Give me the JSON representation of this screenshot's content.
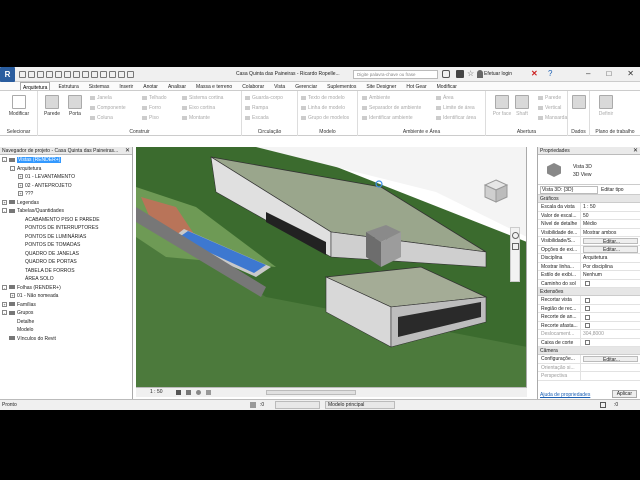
{
  "titlebar": {
    "app_logo": "R",
    "doc_title": "Casa Quinta das Paineiras - Ricardo Ropelle...",
    "search_placeholder": "Digite palavra-chave ou frase",
    "login": "Efetuar login",
    "window_buttons": [
      "–",
      "□",
      "✕"
    ]
  },
  "tabs": [
    "Arquitetura",
    "Estrutura",
    "Sistemas",
    "Inserir",
    "Anotar",
    "Analisar",
    "Massa e terreno",
    "Colaborar",
    "Vista",
    "Gerenciar",
    "Suplementos",
    "Site Designer",
    "Hot Gear",
    "Modificar"
  ],
  "ribbon": {
    "modify": "Modificar",
    "selector": "Selecionar",
    "build": {
      "title": "Construir",
      "big": [
        "Parede",
        "Porta"
      ],
      "items": [
        "Janela",
        "Componente",
        "Coluna",
        "Telhado",
        "Forro",
        "Piso",
        "Sistema cortina",
        "Eixo cortina",
        "Montante"
      ]
    },
    "circulation": {
      "title": "Circulação",
      "items": [
        "Guarda-corpo",
        "Rampa",
        "Escada"
      ]
    },
    "model": {
      "title": "Modelo",
      "items": [
        "Texto de modelo",
        "Linha de modelo",
        "Grupo de modelos"
      ]
    },
    "room": {
      "title": "Ambiente e Área",
      "items": [
        "Ambiente",
        "Separador de ambiente",
        "Identificar ambiente",
        "Área",
        "Limite de área",
        "Identificar área"
      ]
    },
    "opening": {
      "title": "Abertura",
      "items": [
        "Por face",
        "Shaft",
        "Parede",
        "Vertical",
        "Mansarda"
      ]
    },
    "datum": {
      "title": "Dados"
    },
    "workplane": {
      "title": "Plano de trabalho",
      "items": [
        "Definir"
      ]
    }
  },
  "project_browser": {
    "header": "Navegador de projeto - Casa Quinta das Paineiras...",
    "tree": [
      {
        "label": "Vistas (RENDER+)",
        "level": 0,
        "toggle": "-",
        "selected": true
      },
      {
        "label": "Arquitetura",
        "level": 1,
        "toggle": "-"
      },
      {
        "label": "01 - LEVANTAMENTO",
        "level": 2,
        "toggle": "+"
      },
      {
        "label": "02 - ANTEPROJETO",
        "level": 2,
        "toggle": "+"
      },
      {
        "label": "???",
        "level": 2,
        "toggle": "+"
      },
      {
        "label": "Legendas",
        "level": 0,
        "toggle": "+"
      },
      {
        "label": "Tabelas/Quantidades",
        "level": 0,
        "toggle": "-"
      },
      {
        "label": "ACABAMENTO PISO E PAREDE",
        "level": 2
      },
      {
        "label": "PONTOS DE INTERRUPTORES",
        "level": 2
      },
      {
        "label": "PONTOS DE LUMINÁRIAS",
        "level": 2
      },
      {
        "label": "PONTOS DE TOMADAS",
        "level": 2
      },
      {
        "label": "QUADRO DE JANELAS",
        "level": 2
      },
      {
        "label": "QUADRO DE PORTAS",
        "level": 2
      },
      {
        "label": "TABELA DE FORROS",
        "level": 2
      },
      {
        "label": "ÁREA SOLO",
        "level": 2
      },
      {
        "label": "Folhas (RENDER+)",
        "level": 0,
        "toggle": "-"
      },
      {
        "label": "01 - Não nomeada",
        "level": 1,
        "toggle": "+"
      },
      {
        "label": "Famílias",
        "level": 0,
        "toggle": "+"
      },
      {
        "label": "Grupos",
        "level": 0,
        "toggle": "-"
      },
      {
        "label": "Detalhe",
        "level": 1
      },
      {
        "label": "Modelo",
        "level": 1
      },
      {
        "label": "Vínculos do Revit",
        "level": 0
      }
    ]
  },
  "view_control": {
    "scale": "1 : 50"
  },
  "properties": {
    "header": "Propriedades",
    "type_name": "Vista 3D",
    "type_sub": "3D View",
    "instance": "Vista 3D: {3D}",
    "edit_type": "Editar tipo",
    "groups": [
      {
        "name": "Gráficos",
        "rows": [
          [
            "Escala da vista",
            "1 : 50"
          ],
          [
            "Valor de escal...",
            "50"
          ],
          [
            "Nível de detalhe",
            "Médio"
          ],
          [
            "Visibilidade de...",
            "Mostrar ambos"
          ],
          [
            "Visibilidade/S...",
            "Editar...",
            "btn"
          ],
          [
            "Opções de exi...",
            "Editar...",
            "btn"
          ],
          [
            "Disciplina",
            "Arquitetura"
          ],
          [
            "Mostrar linha...",
            "Por disciplina"
          ],
          [
            "Estilo de exibi...",
            "Nenhum"
          ],
          [
            "Caminho do sol",
            "",
            "cb"
          ]
        ]
      },
      {
        "name": "Extensões",
        "rows": [
          [
            "Recortar vista",
            "",
            "cb"
          ],
          [
            "Região de rec...",
            "",
            "cb"
          ],
          [
            "Recorte de an...",
            "",
            "cb"
          ],
          [
            "Recorte afasta...",
            "",
            "cb"
          ],
          [
            "Deslocament...",
            "304,8000",
            "grey"
          ],
          [
            "Caixa de corte",
            "",
            "cb"
          ]
        ]
      },
      {
        "name": "Câmera",
        "rows": [
          [
            "Configuraçõe...",
            "Editar...",
            "btn"
          ],
          [
            "Orientação si...",
            "",
            "grey"
          ],
          [
            "Perspectiva",
            "",
            "grey"
          ]
        ]
      }
    ],
    "help_link": "Ajuda de propriedades",
    "apply": "Aplicar"
  },
  "status": {
    "left": "Pronto",
    "model": "Modelo principal",
    "zero": ":0"
  }
}
